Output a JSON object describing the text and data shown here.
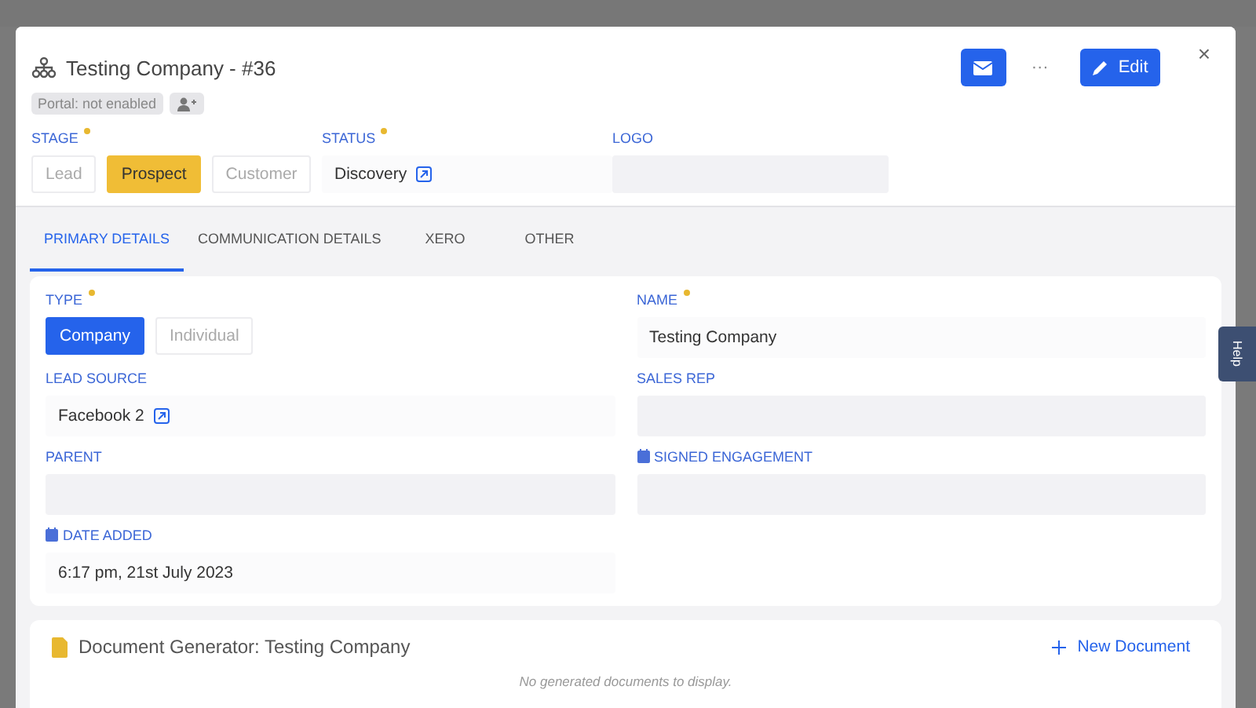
{
  "header": {
    "title": "Testing Company - #36",
    "portal_badge": "Portal: not enabled",
    "actions": {
      "more": "···",
      "edit": "Edit"
    },
    "close": "×"
  },
  "stage": {
    "label": "STAGE",
    "required": true,
    "options": [
      {
        "label": "Lead",
        "selected": false
      },
      {
        "label": "Prospect",
        "selected": true
      },
      {
        "label": "Customer",
        "selected": false
      }
    ]
  },
  "status": {
    "label": "STATUS",
    "required": true,
    "value": "Discovery",
    "link": true
  },
  "logo": {
    "label": "LOGO"
  },
  "tabs": [
    {
      "label": "PRIMARY DETAILS",
      "selected": true
    },
    {
      "label": "COMMUNICATION DETAILS",
      "selected": false
    },
    {
      "label": "XERO",
      "selected": false
    },
    {
      "label": "OTHER",
      "selected": false
    }
  ],
  "type": {
    "label": "TYPE",
    "required": true,
    "options": [
      {
        "label": "Company",
        "selected": true
      },
      {
        "label": "Individual",
        "selected": false
      }
    ]
  },
  "fields": [
    {
      "label": "NAME",
      "required": true,
      "value": "Testing Company",
      "link": false,
      "calendar": false
    },
    {
      "label": "LEAD SOURCE",
      "required": false,
      "value": "Facebook 2",
      "link": true,
      "calendar": false
    },
    {
      "label": "SALES REP",
      "required": false,
      "link": false,
      "calendar": false
    },
    {
      "label": "PARENT",
      "required": false,
      "link": false,
      "calendar": false
    },
    {
      "label": "SIGNED ENGAGEMENT",
      "required": false,
      "link": false,
      "calendar": true
    },
    {
      "label": "DATE ADDED",
      "required": false,
      "value": "6:17 pm, 21st July 2023",
      "link": false,
      "calendar": true
    }
  ],
  "documents": {
    "title": "Document Generator: Testing Company",
    "new_button": "New Document",
    "empty": "No generated documents to display."
  },
  "help": "Help"
}
